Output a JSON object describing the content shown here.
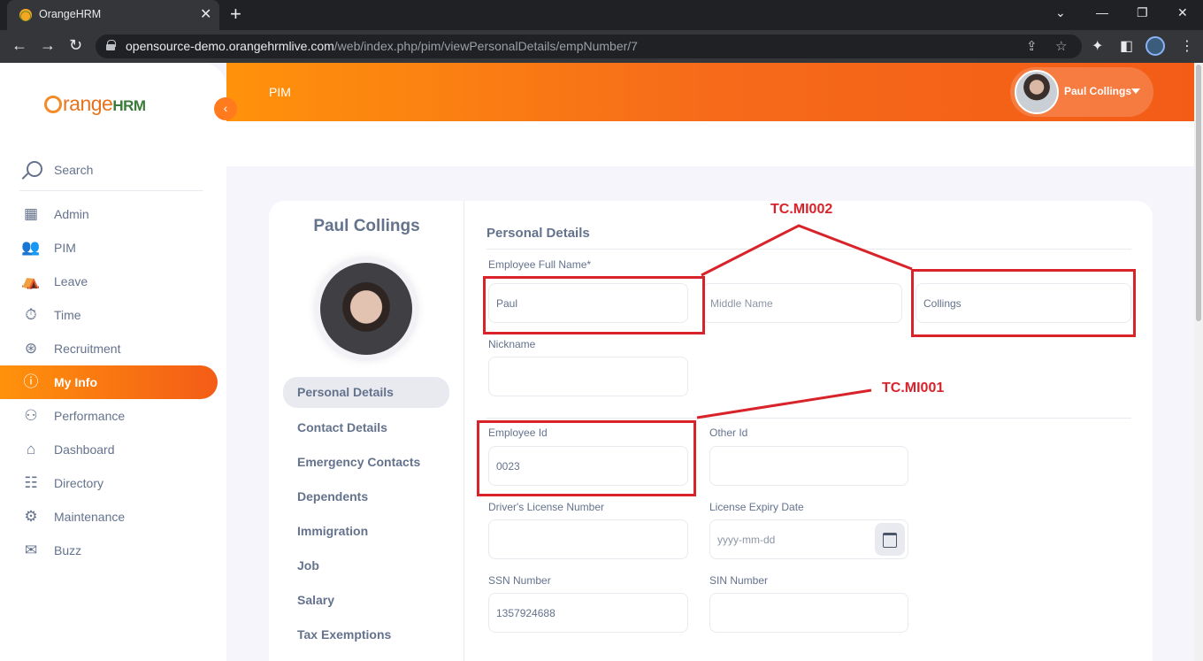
{
  "browser": {
    "tab_title": "OrangeHRM",
    "url_host": "opensource-demo.orangehrmlive.com",
    "url_path": "/web/index.php/pim/viewPersonalDetails/empNumber/7"
  },
  "sidebar": {
    "logo_prefix": "range",
    "logo_suffix": "HRM",
    "search_label": "Search",
    "items": [
      {
        "label": "Admin",
        "icon": "admin-icon",
        "glyph": "▦"
      },
      {
        "label": "PIM",
        "icon": "pim-icon",
        "glyph": "👥"
      },
      {
        "label": "Leave",
        "icon": "leave-icon",
        "glyph": "⛺"
      },
      {
        "label": "Time",
        "icon": "time-icon",
        "glyph": "⏱"
      },
      {
        "label": "Recruitment",
        "icon": "recruitment-icon",
        "glyph": "⊛"
      },
      {
        "label": "My Info",
        "icon": "my-info-icon",
        "glyph": "ⓘ"
      },
      {
        "label": "Performance",
        "icon": "performance-icon",
        "glyph": "⚇"
      },
      {
        "label": "Dashboard",
        "icon": "dashboard-icon",
        "glyph": "⌂"
      },
      {
        "label": "Directory",
        "icon": "directory-icon",
        "glyph": "☷"
      },
      {
        "label": "Maintenance",
        "icon": "maintenance-icon",
        "glyph": "⚙"
      },
      {
        "label": "Buzz",
        "icon": "buzz-icon",
        "glyph": "✉"
      }
    ],
    "active_item": "My Info"
  },
  "topbar": {
    "title": "PIM",
    "user_name": "Paul Collings"
  },
  "profile": {
    "name": "Paul Collings",
    "tabs": [
      "Personal Details",
      "Contact Details",
      "Emergency Contacts",
      "Dependents",
      "Immigration",
      "Job",
      "Salary",
      "Tax Exemptions"
    ],
    "active_tab": "Personal Details"
  },
  "form": {
    "section_title": "Personal Details",
    "full_name_label": "Employee Full Name*",
    "first_name_value": "Paul",
    "middle_name_placeholder": "Middle Name",
    "last_name_value": "Collings",
    "nickname_label": "Nickname",
    "nickname_value": "",
    "employee_id_label": "Employee Id",
    "employee_id_value": "0023",
    "other_id_label": "Other Id",
    "other_id_value": "",
    "license_label": "Driver's License Number",
    "license_value": "",
    "license_expiry_label": "License Expiry Date",
    "license_expiry_placeholder": "yyyy-mm-dd",
    "ssn_label": "SSN Number",
    "ssn_value": "1357924688",
    "sin_label": "SIN Number",
    "sin_value": ""
  },
  "annotations": {
    "label_top": "TC.MI002",
    "label_mid": "TC.MI001",
    "color": "#d9232a"
  },
  "colors": {
    "accent": "#ff7b1d",
    "gradient_start": "#ff920b",
    "gradient_end": "#f35c17"
  }
}
